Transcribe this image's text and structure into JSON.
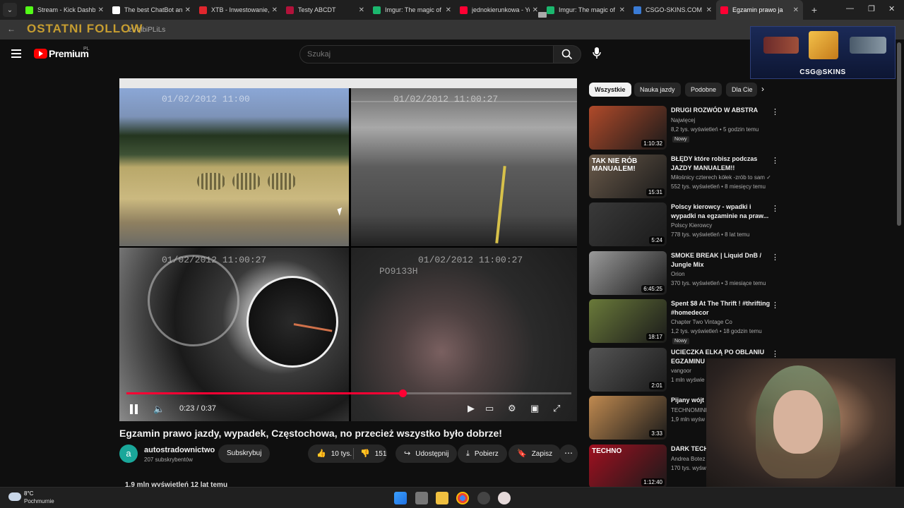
{
  "browser": {
    "tabs": [
      {
        "label": "Stream - Kick Dashbo",
        "color": "#53fc18",
        "active": false
      },
      {
        "label": "The best ChatBot and",
        "color": "#ffffff",
        "active": false
      },
      {
        "label": "XTB - Inwestowanie, t",
        "color": "#e0262d",
        "active": false
      },
      {
        "label": "Testy ABCDT",
        "color": "#b2123a",
        "active": false
      },
      {
        "label": "Imgur: The magic of t",
        "color": "#1bb76e",
        "active": false
      },
      {
        "label": "jednokierunkowa - Yo",
        "color": "#ff0033",
        "active": false
      },
      {
        "label": "Imgur: The magic of t",
        "color": "#1bb76e",
        "active": false
      },
      {
        "label": "CSGO-SKINS.COM - N",
        "color": "#3a7bd5",
        "active": false
      },
      {
        "label": "Egzamin prawo ja",
        "color": "#ff0033",
        "active": true
      }
    ],
    "url_fragment": "zVqlbiPLiLs",
    "overlay_title": "OSTATNI FOLLOW"
  },
  "youtube": {
    "logo_text": "Premium",
    "region": "PL",
    "search_placeholder": "Szukaj"
  },
  "csgo_widget": {
    "brand": "CSG◎SKINS"
  },
  "player": {
    "current_time": "0:23",
    "duration": "0:37",
    "progress": 0.62,
    "osd": {
      "q1": "01/02/2012 11:00",
      "q2": "01/02/2012 11:00:27",
      "q3": "01/02/2012 11:00:27",
      "q4": "01/02/2012 11:00:27",
      "plate": "PO9133H"
    }
  },
  "video": {
    "title": "Egzamin prawo jazdy, wypadek, Częstochowa, no przecież wszystko było dobrze!",
    "channel_initial": "a",
    "channel": "autostradownictwo",
    "subscribers": "207 subskrybentów",
    "subscribe_label": "Subskrybuj",
    "likes": "10 tys.",
    "dislikes": "151",
    "share_label": "Udostępnij",
    "download_label": "Pobierz",
    "save_label": "Zapisz",
    "views_meta": "1,9 mln wyświetleń  12 lat temu"
  },
  "chips": [
    {
      "label": "Wszystkie",
      "active": true
    },
    {
      "label": "Nauka jazdy",
      "active": false
    },
    {
      "label": "Podobne",
      "active": false
    },
    {
      "label": "Dla Cie",
      "active": false
    }
  ],
  "recommendations": [
    {
      "title": "DRUGI ROZWÓD W ABSTRA",
      "channel": "Najwięcej",
      "meta": "8,2 tys. wyświetleń • 5 godzin temu",
      "duration": "1:10:32",
      "badge": "Nowy",
      "thumb_color": "#b04a2a"
    },
    {
      "title": "BŁĘDY które robisz podczas JAZDY MANUALEM!!",
      "channel": "Miłośnicy czterech kółek -zrób to sam ✓",
      "meta": "552 tys. wyświetleń • 8 miesięcy temu",
      "duration": "15:31",
      "badge": "",
      "thumb_color": "#6a5a4a",
      "thumb_text": "TAK NIE RÓB MANUALEM!"
    },
    {
      "title": "Polscy kierowcy - wpadki i wypadki na egzaminie na praw...",
      "channel": "Polscy Kierowcy",
      "meta": "778 tys. wyświetleń • 8 lat temu",
      "duration": "5:24",
      "badge": "",
      "thumb_color": "#3a3a3a"
    },
    {
      "title": "SMOKE BREAK | Liquid DnB / Jungle Mix",
      "channel": "Orion",
      "meta": "370 tys. wyświetleń • 3 miesiące temu",
      "duration": "6:45:25",
      "badge": "",
      "thumb_color": "#9a9a9a"
    },
    {
      "title": "Spent $8 At The Thrift ! #thrifting #homedecor",
      "channel": "Chapter Two Vintage Co",
      "meta": "1,2 tys. wyświetleń • 18 godzin temu",
      "duration": "18:17",
      "badge": "Nowy",
      "thumb_color": "#6a7a3a"
    },
    {
      "title": "UCIECZKA ELKĄ PO OBLANIU EGZAMINU",
      "channel": "vangoor",
      "meta": "1 mln wyświe",
      "duration": "2:01",
      "badge": "",
      "thumb_color": "#555"
    },
    {
      "title": "Pijany wójt :",
      "channel": "TECHNOMINI",
      "meta": "1,9 mln wyśw",
      "duration": "3:33",
      "badge": "",
      "thumb_color": "#c08a50"
    },
    {
      "title": "DARK TECH Botez [4K]",
      "channel": "Andrea Botez",
      "meta": "170 tys. wyśw",
      "duration": "1:12:40",
      "badge": "",
      "thumb_color": "#a01020",
      "thumb_text": "TECHNO"
    }
  ],
  "taskbar": {
    "weather_temp": "8°C",
    "weather_desc": "Pochmurnie"
  }
}
